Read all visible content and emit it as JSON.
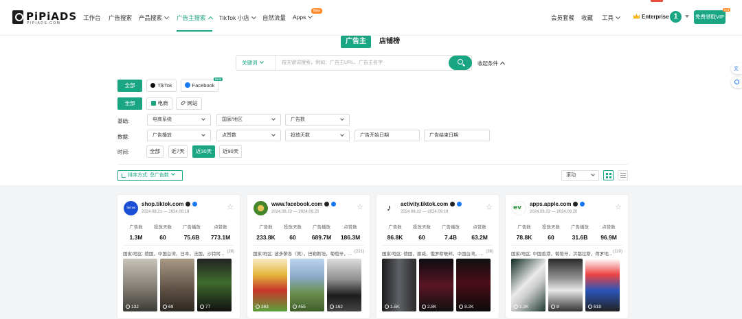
{
  "nav": {
    "logo_text": "PiPiADS",
    "logo_sub": "PIPIADS.COM",
    "items": [
      "工作台",
      "广告搜索",
      "产品搜索",
      "广告主搜索",
      "TikTok 小店",
      "自然流量",
      "Apps"
    ],
    "new_badge": "New",
    "right_items": [
      "会员套餐",
      "收藏",
      "工具"
    ],
    "plan": "Enterprise",
    "avatar": "1",
    "vip_button": "免费领取VIP",
    "vip_badge": "Hot"
  },
  "tabs": [
    "广告主",
    "店铺榜"
  ],
  "search": {
    "select": "关键词",
    "placeholder": "按关键词搜索，例如：广告主URL、广告主名字",
    "collapse": "收起条件"
  },
  "platform": {
    "all": "全部",
    "tiktok": "TikTok",
    "facebook": "Facebook",
    "beta": "Beta"
  },
  "type": {
    "all": "全部",
    "ecom": "电商",
    "web": "网站"
  },
  "filters": {
    "basic_label": "基础:",
    "basic": [
      "电商系统",
      "国家/地区",
      "广告数"
    ],
    "data_label": "数据:",
    "data": [
      "广告播放",
      "点赞数",
      "投放天数",
      "广告开始日期",
      "广告结束日期"
    ],
    "time_label": "时间:",
    "time": [
      "全部",
      "近7天",
      "近30天",
      "近90天"
    ]
  },
  "sort": {
    "label": "排序方式: 总广告数",
    "scroll": "滚动"
  },
  "stat_labels": [
    "广告数",
    "投放天数",
    "广告播放",
    "点赞数"
  ],
  "cards": [
    {
      "name": "shop.tiktok.com",
      "dates": "2024.08.21 — 2024.09.18",
      "logo_text": "TIKTOK",
      "stats": [
        "1.3M",
        "60",
        "75.6B",
        "773.1M"
      ],
      "region": "国家/地区: 德国，中国台湾，日本，法国，沙特阿...",
      "region_count": "(28)",
      "views": [
        "132",
        "69",
        "77"
      ]
    },
    {
      "name": "www.facebook.com",
      "dates": "2024.08.22 — 2024.09.20",
      "stats": [
        "233.8K",
        "60",
        "689.7M",
        "186.3M"
      ],
      "region": "国家/地区: 波多黎各（美），巴勒斯坦，葡萄牙，...",
      "region_count": "(221)",
      "views": [
        "363",
        "455",
        "162"
      ]
    },
    {
      "name": "activity.tiktok.com",
      "dates": "2024.08.22 — 2024.09.19",
      "stats": [
        "86.8K",
        "60",
        "7.4B",
        "63.2M"
      ],
      "region": "国家/地区: 德国，挪威，俄罗斯联邦，中国台湾，...",
      "region_count": "(38)",
      "views": [
        "1.5K",
        "2.8K",
        "8.2K"
      ]
    },
    {
      "name": "apps.apple.com",
      "dates": "2024.08.22 — 2024.09.20",
      "stats": [
        "78.8K",
        "60",
        "31.6B",
        "96.9M"
      ],
      "region": "国家/地区: 中国香港，葡萄牙，洪都拉斯，荷罗地...",
      "region_count": "(110)",
      "views": [
        "1.3K",
        "8",
        "618"
      ]
    }
  ],
  "colors": {
    "accent": "#1aa583",
    "badge": "#ff8a2b"
  }
}
